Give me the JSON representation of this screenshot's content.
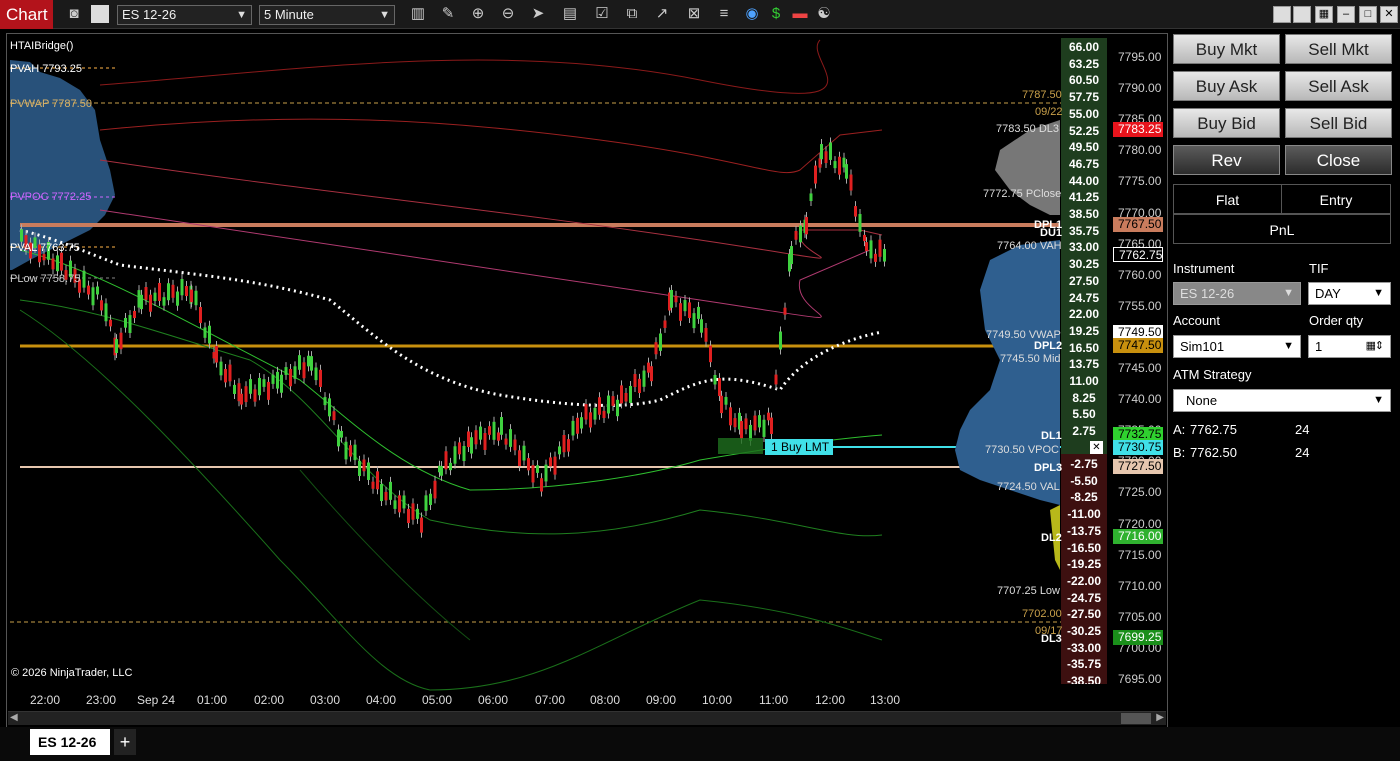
{
  "app": {
    "title": "Chart"
  },
  "toolbar": {
    "instrument": "ES 12-26",
    "interval": "5 Minute",
    "icons": [
      "camera-icon",
      "color-swatch-icon",
      "bar-style-icon",
      "draw-pencil-icon",
      "zoom-in-icon",
      "zoom-out-icon",
      "pointer-icon",
      "data-box-icon",
      "properties-icon",
      "strategy-icon",
      "drawing-tool-icon",
      "indicator-icon",
      "palette-icon",
      "dollar-icon",
      "stack-icon",
      "yin-yang-icon"
    ],
    "window_icons": [
      "tile-icon",
      "tile-icon",
      "grid-icon",
      "minimize-icon",
      "maximize-icon",
      "close-icon"
    ]
  },
  "chart": {
    "indicator": "HTAIBridge()",
    "copyright": "© 2026 NinjaTrader, LLC",
    "ref_lines": [
      {
        "label": "PVAH  7793.25",
        "color": "#ffb347"
      },
      {
        "label": "PVWAP  7787.50",
        "color": "#d9b36a"
      },
      {
        "label": "PVPOC  7772.25",
        "color": "#cc66ff"
      },
      {
        "label": "PVAL  7763.75",
        "color": "#ffb347"
      },
      {
        "label": "PLow  7758.75",
        "color": "#cccccc"
      }
    ],
    "price_axis": [
      "7795.00",
      "7790.00",
      "7785.00",
      "7780.00",
      "7775.00",
      "7770.00",
      "7765.00",
      "7760.00",
      "7755.00",
      "7750.00",
      "7745.00",
      "7740.00",
      "7735.00",
      "7730.00",
      "7725.00",
      "7720.00",
      "7715.00",
      "7710.00",
      "7705.00",
      "7700.00",
      "7695.00"
    ],
    "time_axis": [
      "22:00",
      "23:00",
      "Sep 24",
      "01:00",
      "02:00",
      "03:00",
      "04:00",
      "05:00",
      "06:00",
      "07:00",
      "08:00",
      "09:00",
      "10:00",
      "11:00",
      "12:00",
      "13:00"
    ],
    "pnl_ladder_pos": [
      "66.00",
      "63.25",
      "60.50",
      "57.75",
      "55.00",
      "52.25",
      "49.50",
      "46.75",
      "44.00",
      "41.25",
      "38.50",
      "35.75",
      "33.00",
      "30.25",
      "27.50",
      "24.75",
      "22.00",
      "19.25",
      "16.50",
      "13.75",
      "11.00",
      "8.25",
      "5.50",
      "2.75"
    ],
    "pnl_ladder_neg": [
      "-2.75",
      "-5.50",
      "-8.25",
      "-11.00",
      "-13.75",
      "-16.50",
      "-19.25",
      "-22.00",
      "-24.75",
      "-27.50",
      "-30.25",
      "-33.00",
      "-35.75",
      "-38.50"
    ],
    "price_tags": [
      {
        "value": "7783.25",
        "bg": "#e8141c",
        "fg": "#ffffff"
      },
      {
        "value": "7767.50",
        "bg": "#c97c5d",
        "fg": "#000000"
      },
      {
        "value": "7762.75",
        "bg": "#000000",
        "fg": "#ffffff"
      },
      {
        "value": "7749.50",
        "bg": "#ffffff",
        "fg": "#000000"
      },
      {
        "value": "7747.50",
        "bg": "#c8900e",
        "fg": "#000000"
      },
      {
        "value": "7732.75",
        "bg": "#2fd12f",
        "fg": "#000000"
      },
      {
        "value": "7730.75",
        "bg": "#40e0e8",
        "fg": "#000000"
      },
      {
        "value": "7727.50",
        "bg": "#e6c6ae",
        "fg": "#000000"
      },
      {
        "value": "7716.00",
        "bg": "#2fb12f",
        "fg": "#ffffff"
      },
      {
        "value": "7699.25",
        "bg": "#1a8f1a",
        "fg": "#ffffff"
      }
    ],
    "vp_labels": [
      "7787.50",
      "09/22",
      "7783.50  DL3",
      "7772.75  PClose",
      "7764.00  VAH",
      "7749.50  VWAP",
      "7745.50  Mid",
      "7730.50  VPOC",
      "7724.50  VAL",
      "7707.25  Low",
      "7702.00",
      "09/17"
    ],
    "dl_labels": [
      "DPL1",
      "DU1",
      "DPL2",
      "DL1",
      "DPL3",
      "DL2",
      "DL3"
    ],
    "order": {
      "label": "1 Buy LMT",
      "close": "✕"
    }
  },
  "tabs": {
    "instrument": "ES 12-26",
    "add": "+"
  },
  "panel": {
    "buy_mkt": "Buy Mkt",
    "sell_mkt": "Sell Mkt",
    "buy_ask": "Buy Ask",
    "sell_ask": "Sell Ask",
    "buy_bid": "Buy Bid",
    "sell_bid": "Sell Bid",
    "rev": "Rev",
    "close": "Close",
    "flat": "Flat",
    "entry": "Entry",
    "pnl": "PnL",
    "instrument_label": "Instrument",
    "instrument_value": "ES 12-26",
    "tif_label": "TIF",
    "tif_value": "DAY",
    "account_label": "Account",
    "account_value": "Sim101",
    "qty_label": "Order qty",
    "qty_value": "1",
    "atm_label": "ATM Strategy",
    "atm_value": "None",
    "ask_label": "A:",
    "ask_price": "7762.75",
    "ask_size": "24",
    "bid_label": "B:",
    "bid_price": "7762.50",
    "bid_size": "24"
  }
}
